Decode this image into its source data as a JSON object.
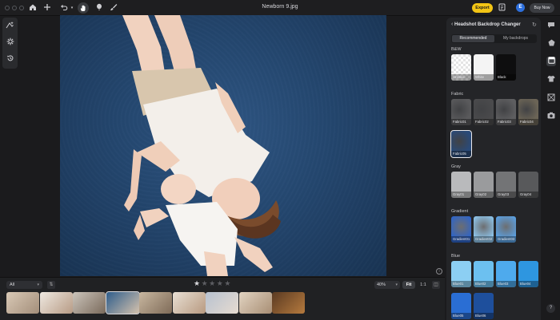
{
  "window": {
    "title": "Newborn 9.jpg"
  },
  "toolbar": {
    "export_label": "Export",
    "avatar_initial": "E",
    "buy_label": "Buy Now"
  },
  "panel": {
    "title": "Headshot Backdrop Changer",
    "tabs": [
      {
        "label": "Recommended",
        "active": true
      },
      {
        "label": "My backdrops",
        "active": false
      }
    ],
    "sections": [
      {
        "label": "B&W",
        "swatches": [
          {
            "label": "Untitled",
            "color": "checker"
          },
          {
            "label": "White",
            "color": "#f4f4f4"
          },
          {
            "label": "Black",
            "color": "#0e0e0f"
          }
        ]
      },
      {
        "label": "Fabric",
        "swatches": [
          {
            "label": "Fabric01",
            "color": "#5a5a5c"
          },
          {
            "label": "Fabric02",
            "color": "#4a4a4c"
          },
          {
            "label": "Fabric03",
            "color": "#5e5e60"
          },
          {
            "label": "Fabric04",
            "color": "#6b6456"
          },
          {
            "label": "Fabric05",
            "color": "#2a4a78",
            "selected": true
          }
        ]
      },
      {
        "label": "Gray",
        "swatches": [
          {
            "label": "Gray01",
            "color": "#b9babc"
          },
          {
            "label": "Gray02",
            "color": "#9a9b9d"
          },
          {
            "label": "Gray03",
            "color": "#737476"
          },
          {
            "label": "Gray04",
            "color": "#58595b"
          }
        ]
      },
      {
        "label": "Gradient",
        "swatches": [
          {
            "label": "Gradient01",
            "color": "#2e64c8"
          },
          {
            "label": "Gradient02",
            "color": "#8dc4ea"
          },
          {
            "label": "Gradient03",
            "color": "#5aa0e2"
          }
        ]
      },
      {
        "label": "Blue",
        "swatches": [
          {
            "label": "Blue01",
            "color": "#8ccff3"
          },
          {
            "label": "Blue02",
            "color": "#6cc0f0"
          },
          {
            "label": "Blue03",
            "color": "#4eaaed"
          },
          {
            "label": "Blue04",
            "color": "#2e96e0"
          },
          {
            "label": "Blue05",
            "color": "#2a6ed4"
          },
          {
            "label": "Blue06",
            "color": "#1e4f9c"
          }
        ]
      }
    ]
  },
  "bottombar": {
    "filter": "All",
    "rating": 1,
    "rating_max": 5,
    "zoom": "40%",
    "fit_label": "Fit",
    "one_to_one_label": "1:1",
    "thumbnails": [
      {
        "name": "thumb-1",
        "colors": [
          "#d9c9b6",
          "#a38e7a"
        ]
      },
      {
        "name": "thumb-2",
        "colors": [
          "#efe9e1",
          "#b79b85"
        ]
      },
      {
        "name": "thumb-3",
        "colors": [
          "#cbc4bb",
          "#7a6a5b"
        ]
      },
      {
        "name": "thumb-4",
        "colors": [
          "#2e5d8b",
          "#d5c2ad"
        ],
        "selected": true
      },
      {
        "name": "thumb-5",
        "colors": [
          "#c8b7a0",
          "#7f6b58"
        ]
      },
      {
        "name": "thumb-6",
        "colors": [
          "#e8dfd4",
          "#b89a80"
        ]
      },
      {
        "name": "thumb-7",
        "colors": [
          "#b8c2d0",
          "#e6dbd0"
        ]
      },
      {
        "name": "thumb-8",
        "colors": [
          "#e2d4c2",
          "#a88e74"
        ]
      },
      {
        "name": "thumb-9",
        "colors": [
          "#5a3a22",
          "#b57a3e"
        ]
      }
    ]
  },
  "icons": {
    "home": "home-icon",
    "add": "plus-icon",
    "undo": "undo-icon",
    "hand": "hand-icon",
    "balloon": "balloon-icon",
    "brush": "brush-icon"
  }
}
